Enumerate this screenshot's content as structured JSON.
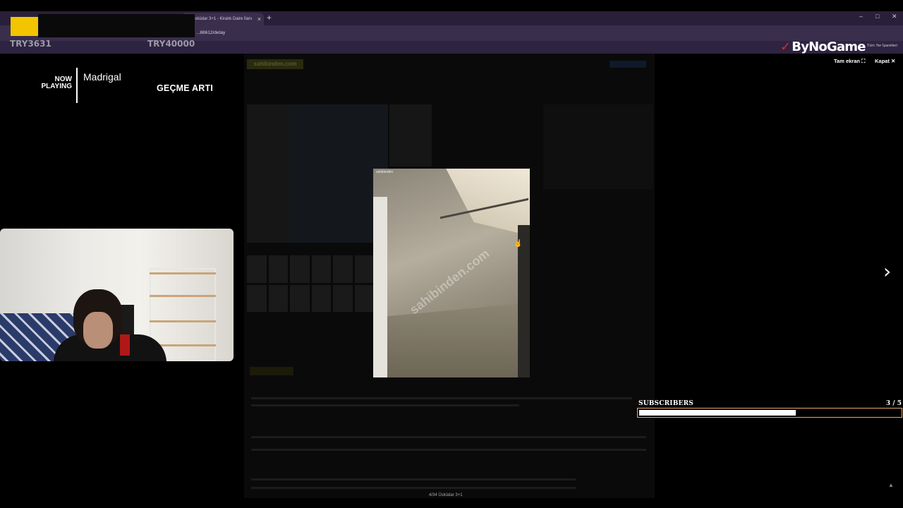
{
  "browser": {
    "tab_title": "Üsküdar 3+1 - Kiralık Daire İlanı",
    "tab_close": "×",
    "new_tab": "+",
    "url": "...88612/detay",
    "bookmarks_label": "Tüm Yer İşaretleri",
    "window_minimize": "–",
    "window_restore": "□",
    "window_close": "✕"
  },
  "donations": {
    "left": "TRY3631",
    "right": "TRY40000"
  },
  "now_playing": {
    "label_line1": "NOW",
    "label_line2": "PLAYING",
    "title": "Madrigal"
  },
  "overlay_text": "GEÇME ARTI",
  "brand": {
    "name": "ByNoGame",
    "mark": "✓"
  },
  "site": {
    "logo": "sahibinden.com"
  },
  "lightbox": {
    "fullscreen_label": "Tam ekran",
    "fullscreen_icon": "⛶",
    "close_label": "Kapat",
    "close_icon": "✕",
    "next_icon": "›",
    "scroll_top_icon": "▲",
    "photo_watermark": "sahibinden.com",
    "photo_tag": "sahibinden",
    "caption": "4/34 Üsküdar 3+1"
  },
  "subscribers": {
    "label": "SUBSCRIBERS",
    "count": "3 / 5",
    "progress": 0.6
  },
  "colors": {
    "accent_yellow": "#f2c500",
    "brand_red": "#e0262b",
    "bar_border": "#e8a86a"
  }
}
